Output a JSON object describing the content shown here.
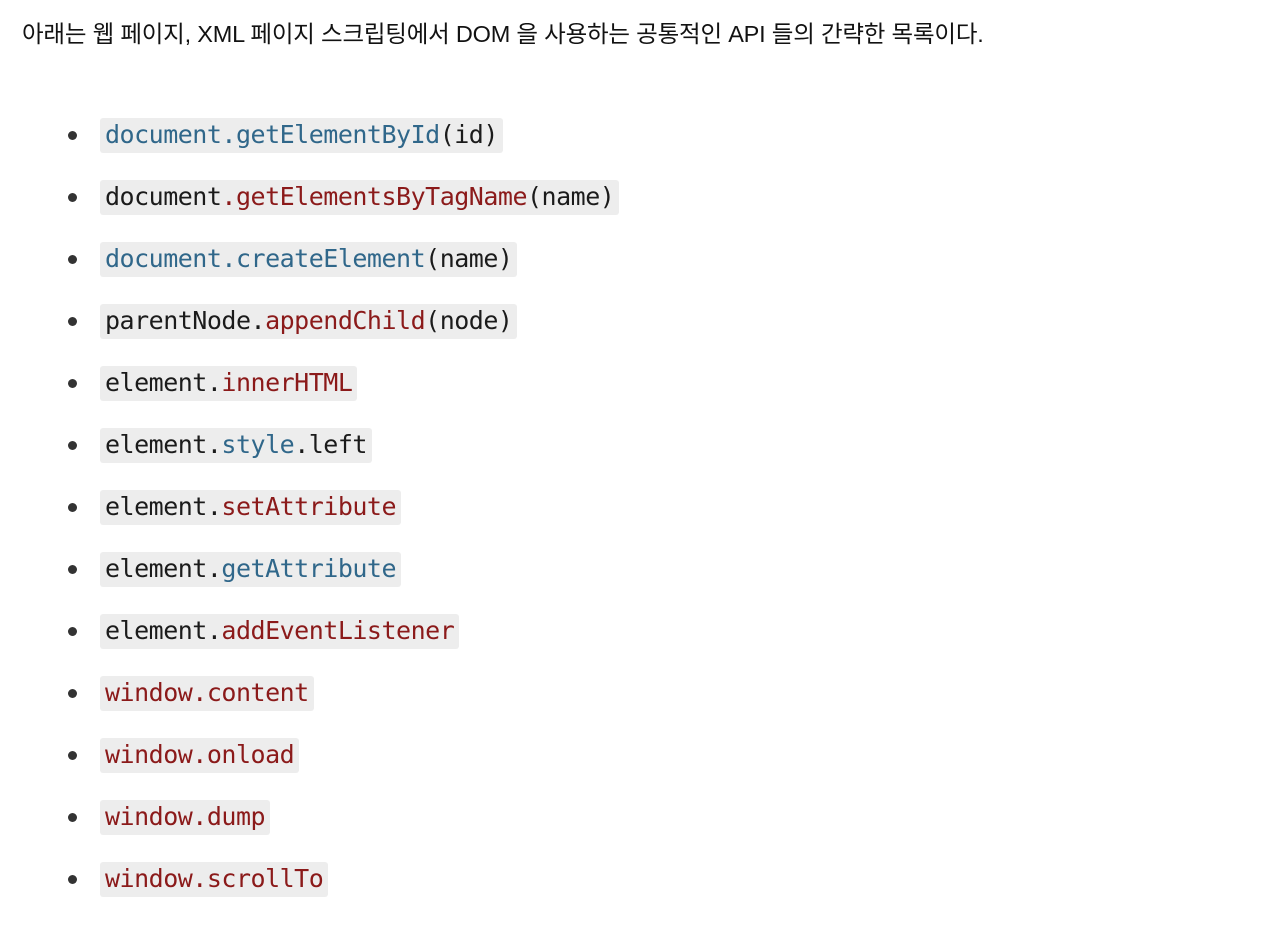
{
  "page": {
    "background_color": "#ffffff",
    "intro_text": "아래는 웹 페이지, XML 페이지 스크립팅에서 DOM 을 사용하는 공통적인 API 들의 간략한 목록이다."
  },
  "colors": {
    "text": "#1b1b1b",
    "link_blue": "#30678a",
    "method_red": "#8b1a1a",
    "code_background": "#ededed",
    "bullet": "#333333"
  },
  "api_list": [
    {
      "full_text": "document.getElementById(id)",
      "segments": [
        {
          "text": "document.getElementById",
          "color": "blue"
        },
        {
          "text": "(id)",
          "color": "plain"
        }
      ]
    },
    {
      "full_text": "document.getElementsByTagName(name)",
      "segments": [
        {
          "text": "document",
          "color": "plain"
        },
        {
          "text": ".getElementsByTagName",
          "color": "red"
        },
        {
          "text": "(name)",
          "color": "plain"
        }
      ]
    },
    {
      "full_text": "document.createElement(name)",
      "segments": [
        {
          "text": "document.createElement",
          "color": "blue"
        },
        {
          "text": "(name)",
          "color": "plain"
        }
      ]
    },
    {
      "full_text": "parentNode.appendChild(node)",
      "segments": [
        {
          "text": "parentNode.",
          "color": "plain"
        },
        {
          "text": "appendChild",
          "color": "red"
        },
        {
          "text": "(node)",
          "color": "plain"
        }
      ]
    },
    {
      "full_text": "element.innerHTML",
      "segments": [
        {
          "text": "element.",
          "color": "plain"
        },
        {
          "text": "innerHTML",
          "color": "red"
        }
      ]
    },
    {
      "full_text": "element.style.left",
      "segments": [
        {
          "text": "element.",
          "color": "plain"
        },
        {
          "text": "style",
          "color": "blue"
        },
        {
          "text": ".left",
          "color": "plain"
        }
      ]
    },
    {
      "full_text": "element.setAttribute",
      "segments": [
        {
          "text": "element.",
          "color": "plain"
        },
        {
          "text": "setAttribute",
          "color": "red"
        }
      ]
    },
    {
      "full_text": "element.getAttribute",
      "segments": [
        {
          "text": "element.",
          "color": "plain"
        },
        {
          "text": "getAttribute",
          "color": "blue"
        }
      ]
    },
    {
      "full_text": "element.addEventListener",
      "segments": [
        {
          "text": "element.",
          "color": "plain"
        },
        {
          "text": "addEventListener",
          "color": "red"
        }
      ]
    },
    {
      "full_text": "window.content",
      "segments": [
        {
          "text": "window.content",
          "color": "red"
        }
      ]
    },
    {
      "full_text": "window.onload",
      "segments": [
        {
          "text": "window.onload",
          "color": "red"
        }
      ]
    },
    {
      "full_text": "window.dump",
      "segments": [
        {
          "text": "window.dump",
          "color": "red"
        }
      ]
    },
    {
      "full_text": "window.scrollTo",
      "segments": [
        {
          "text": "window.scrollTo",
          "color": "red"
        }
      ]
    }
  ]
}
